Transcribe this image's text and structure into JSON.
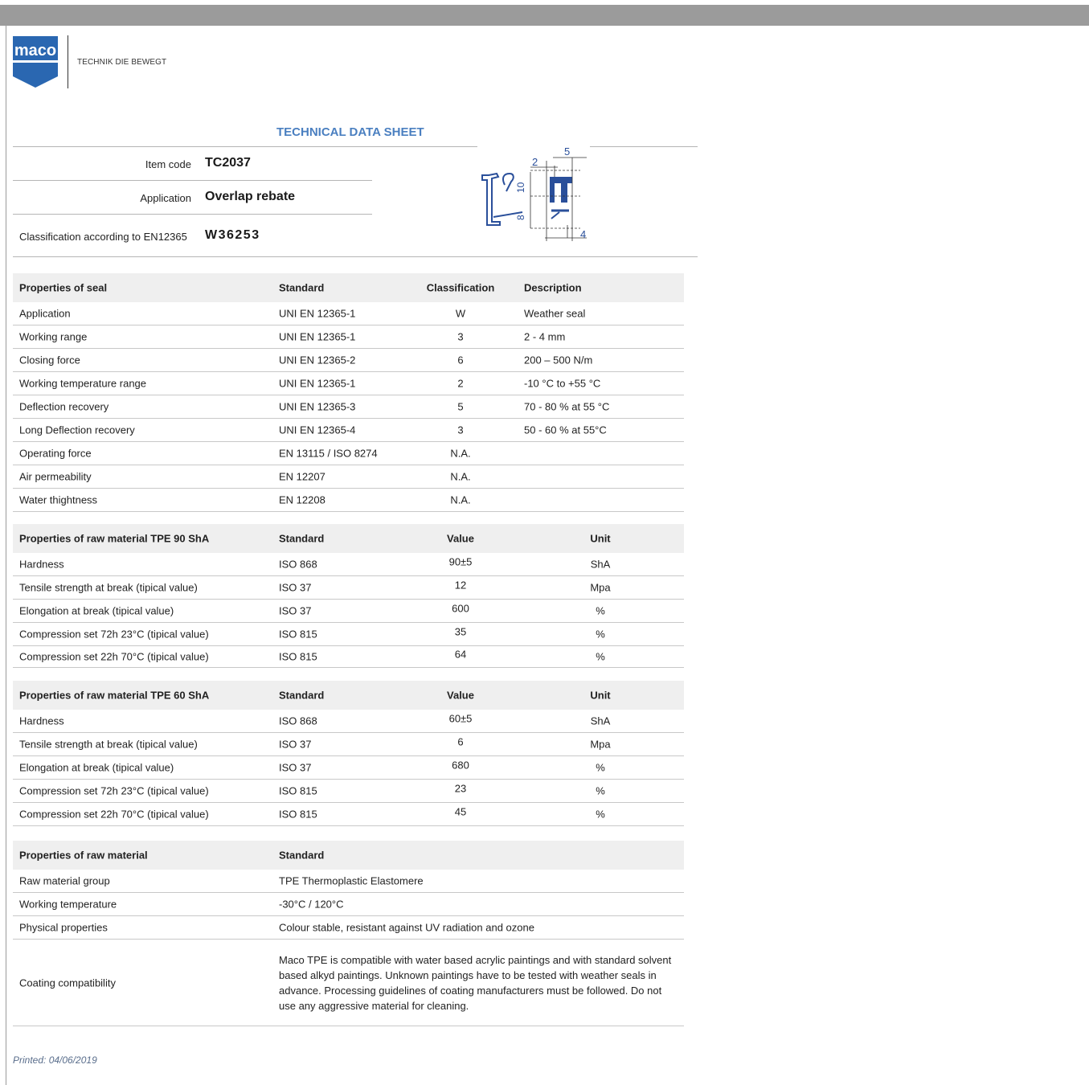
{
  "header": {
    "logo_text": "maco",
    "tagline": "TECHNIK DIE BEWEGT"
  },
  "title": "TECHNICAL DATA SHEET",
  "item": {
    "code_label": "Item code",
    "code_value": "TC2037",
    "application_label": "Application",
    "application_value": "Overlap rebate",
    "classification_label": "Classification according to EN12365",
    "classification_value": "W36253"
  },
  "drawing": {
    "dims": [
      "5",
      "2",
      "10",
      "8",
      "4"
    ]
  },
  "seal_table": {
    "headers": [
      "Properties of seal",
      "Standard",
      "Classification",
      "Description"
    ],
    "rows": [
      [
        "Application",
        "UNI EN 12365-1",
        "W",
        "Weather seal"
      ],
      [
        "Working range",
        "UNI EN 12365-1",
        "3",
        "2 - 4 mm"
      ],
      [
        "Closing force",
        "UNI EN 12365-2",
        "6",
        "200 – 500 N/m"
      ],
      [
        "Working temperature range",
        "UNI EN 12365-1",
        "2",
        "-10 °C to +55 °C"
      ],
      [
        "Deflection recovery",
        "UNI EN 12365-3",
        "5",
        "70 - 80 % at 55 °C"
      ],
      [
        "Long Deflection recovery",
        "UNI EN 12365-4",
        "3",
        "50 - 60 % at 55°C"
      ],
      [
        "Operating force",
        "EN 13115 / ISO 8274",
        "N.A.",
        ""
      ],
      [
        "Air permeability",
        "EN 12207",
        "N.A.",
        ""
      ],
      [
        "Water thightness",
        "EN 12208",
        "N.A.",
        ""
      ]
    ]
  },
  "tpe90_table": {
    "headers": [
      "Properties of raw material TPE 90  ShA",
      "Standard",
      "Value",
      "Unit"
    ],
    "rows": [
      [
        "Hardness",
        "ISO 868",
        "90±5",
        "ShA"
      ],
      [
        "Tensile strength at break (tipical value)",
        "ISO 37",
        "12",
        "Mpa"
      ],
      [
        "Elongation at break (tipical value)",
        "ISO 37",
        "600",
        "%"
      ],
      [
        "Compression set 72h  23°C (tipical value)",
        "ISO 815",
        "35",
        "%"
      ],
      [
        "Compression set 22h 70°C (tipical value)",
        "ISO 815",
        "64",
        "%"
      ]
    ]
  },
  "tpe60_table": {
    "headers": [
      "Properties of raw material TPE 60  ShA",
      "Standard",
      "Value",
      "Unit"
    ],
    "rows": [
      [
        "Hardness",
        "ISO 868",
        "60±5",
        "ShA"
      ],
      [
        "Tensile strength at break (tipical value)",
        "ISO 37",
        "6",
        "Mpa"
      ],
      [
        "Elongation at break (tipical value)",
        "ISO 37",
        "680",
        "%"
      ],
      [
        "Compression set 72h  23°C (tipical value)",
        "ISO 815",
        "23",
        "%"
      ],
      [
        "Compression set 22h 70°C (tipical value)",
        "ISO 815",
        "45",
        "%"
      ]
    ]
  },
  "raw_table": {
    "headers": [
      "Properties of raw material",
      "Standard"
    ],
    "rows": [
      [
        "Raw material group",
        "TPE  Thermoplastic Elastomere"
      ],
      [
        "Working temperature",
        "-30°C / 120°C"
      ],
      [
        "Physical properties",
        "Colour stable, resistant against UV radiation and ozone"
      ],
      [
        "Coating compatibility",
        "Maco TPE is compatible with water based acrylic paintings and with standard solvent based alkyd paintings. Unknown paintings have to be tested with weather seals in advance. Processing guidelines of coating manufacturers must be followed. Do not use any aggressive material for cleaning."
      ]
    ]
  },
  "footer": {
    "printed": "Printed: 04/06/2019"
  },
  "colors": {
    "brand_blue": "#2a67b1",
    "title_blue": "#4a7fc0",
    "header_gray": "#efefef"
  }
}
